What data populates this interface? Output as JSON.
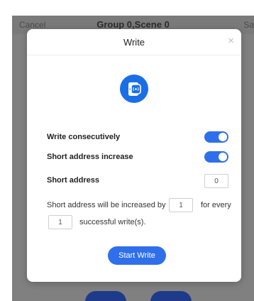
{
  "background": {
    "cancel_label": "Cancel",
    "title": "Group 0,Scene 0",
    "save_label": "Sav"
  },
  "dialog": {
    "title": "Write",
    "close_symbol": "×",
    "icon": "nfc-write-icon",
    "write_consecutively": {
      "label": "Write consecutively",
      "enabled": true
    },
    "short_address_increase": {
      "label": "Short address increase",
      "enabled": true
    },
    "short_address": {
      "label": "Short address",
      "value": "0"
    },
    "increment_sentence": {
      "part1": "Short address will be increased by",
      "step_value": "1",
      "part2": "for every",
      "count_value": "1",
      "part3": "successful write(s)."
    },
    "start_button_label": "Start Write"
  },
  "colors": {
    "accent": "#2f6fea",
    "overlay": "#808080"
  }
}
